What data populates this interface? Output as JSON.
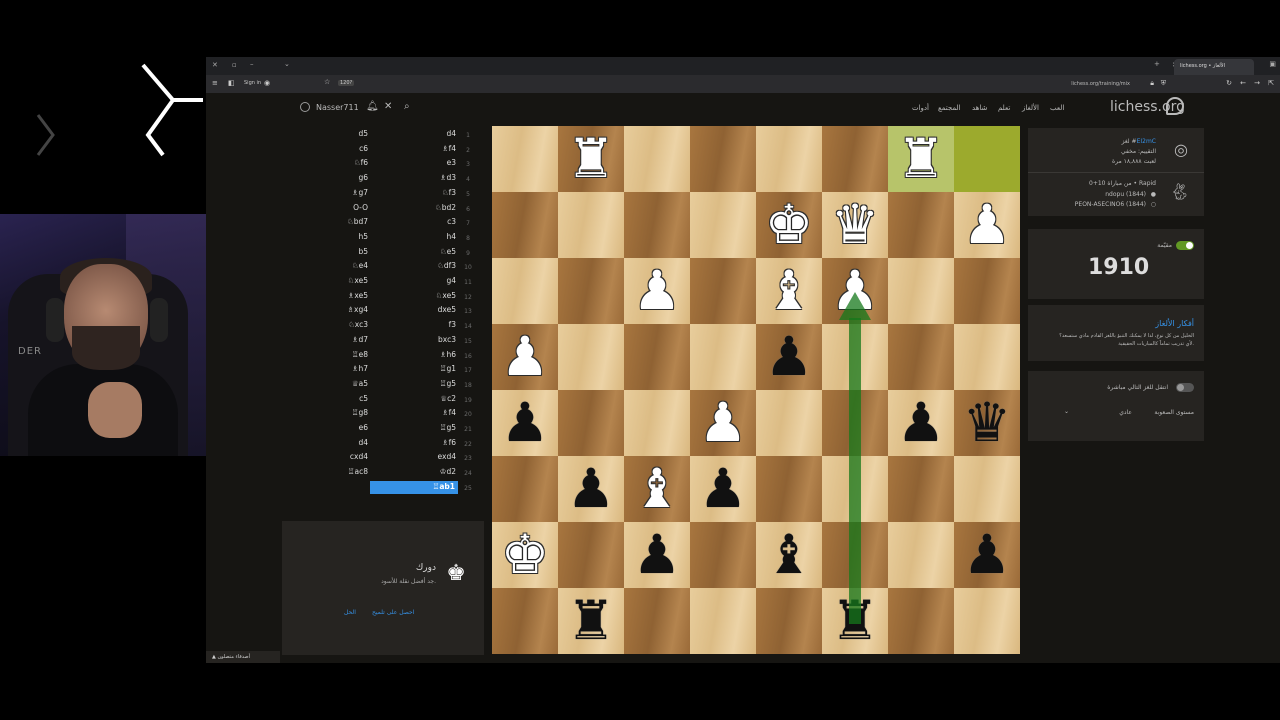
{
  "browser": {
    "tab_title": "lichess.org • الألغاز",
    "signin": "Sign in",
    "tab_badge": "120?",
    "url": "lichess.org/training/mix"
  },
  "header": {
    "username": "Nasser711",
    "logo": "lichess.org",
    "nav": [
      "العب",
      "الألغاز",
      "تعلم",
      "شاهد",
      "المجتمع",
      "أدوات"
    ]
  },
  "moves": [
    {
      "n": "1",
      "w": "d4",
      "b": "d5"
    },
    {
      "n": "2",
      "w": "♗f4",
      "b": "c6"
    },
    {
      "n": "3",
      "w": "e3",
      "b": "♘f6"
    },
    {
      "n": "4",
      "w": "♗d3",
      "b": "g6"
    },
    {
      "n": "5",
      "w": "♘f3",
      "b": "♗g7"
    },
    {
      "n": "6",
      "w": "♘bd2",
      "b": "O-O"
    },
    {
      "n": "7",
      "w": "c3",
      "b": "♘bd7"
    },
    {
      "n": "8",
      "w": "h4",
      "b": "h5"
    },
    {
      "n": "9",
      "w": "♘e5",
      "b": "b5"
    },
    {
      "n": "10",
      "w": "♘df3",
      "b": "♘e4"
    },
    {
      "n": "11",
      "w": "g4",
      "b": "♘xe5"
    },
    {
      "n": "12",
      "w": "♘xe5",
      "b": "♗xe5"
    },
    {
      "n": "13",
      "w": "dxe5",
      "b": "♗xg4"
    },
    {
      "n": "14",
      "w": "f3",
      "b": "♘xc3"
    },
    {
      "n": "15",
      "w": "bxc3",
      "b": "♗d7"
    },
    {
      "n": "16",
      "w": "♗h6",
      "b": "♖e8"
    },
    {
      "n": "17",
      "w": "♖g1",
      "b": "♗h7"
    },
    {
      "n": "18",
      "w": "♖g5",
      "b": "♕a5"
    },
    {
      "n": "19",
      "w": "♕c2",
      "b": "c5"
    },
    {
      "n": "20",
      "w": "♗f4",
      "b": "♖g8"
    },
    {
      "n": "21",
      "w": "♖g5",
      "b": "e6"
    },
    {
      "n": "22",
      "w": "♗f6",
      "b": "d4"
    },
    {
      "n": "23",
      "w": "exd4",
      "b": "cxd4"
    },
    {
      "n": "24",
      "w": "♔d2",
      "b": "♖ac8"
    },
    {
      "n": "25",
      "w": "♖ab1",
      "b": ""
    }
  ],
  "turn": {
    "title": "دورك",
    "subtitle": "جد أفضل نقلة للأسود.",
    "hint": "احصل على تلميح",
    "solution": "الحل"
  },
  "friends": "أصدقاء متصلون",
  "puzzle": {
    "id": "EI2mC",
    "by": "لغز #",
    "rating_label": "التقييم: مخفي",
    "plays": "لعبت ١٨,٨٨٨ مرة",
    "game": "من مباراة 10+0 • Rapid",
    "player1": "ndopu (1844)",
    "player2": "PEON-ASECINO6 (1844)"
  },
  "user_rating": {
    "label": "مقيّمة",
    "value": "1910"
  },
  "themes": {
    "title": "أفكار الألغاز",
    "text1": "الخليل من كل نوع، لذا لا يمكنك التنبؤ باللغز القادم ماذي ستسعد؟",
    "text2": "لأي تدريب تماماً كالمباريات الحقيقية."
  },
  "settings": {
    "jump_next": "انتقل للغز التالي مباشرة",
    "difficulty_label": "مستوى الصعوبة",
    "difficulty_value": "عادي"
  },
  "colors": {
    "accent": "#3692e7",
    "arrow": "#15781b",
    "lastmove": "#9caa2d"
  }
}
